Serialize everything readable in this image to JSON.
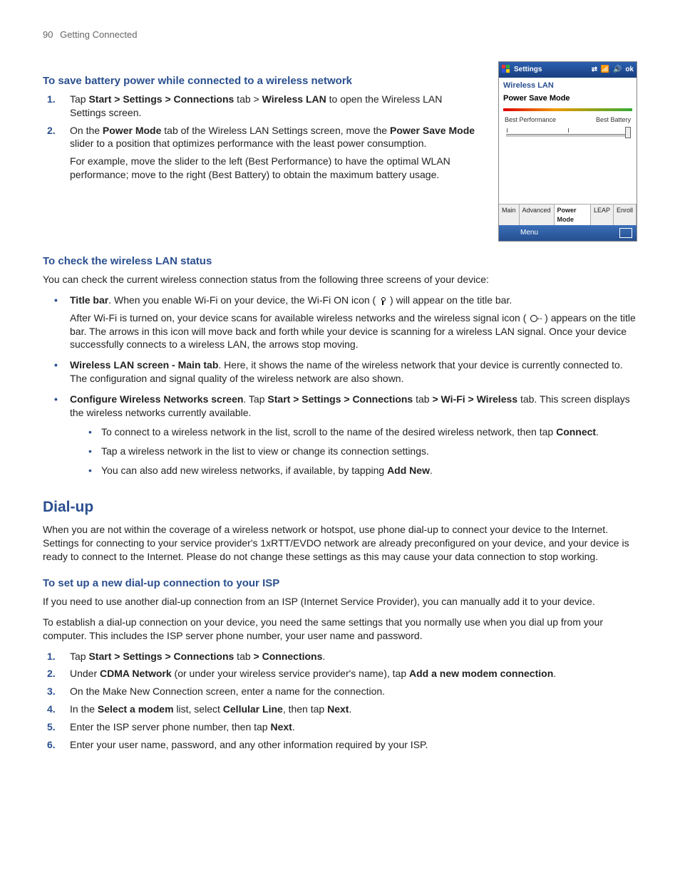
{
  "header": {
    "page_number": "90",
    "chapter": "Getting Connected"
  },
  "sec1": {
    "title": "To save battery power while connected to a wireless network",
    "step1_pre": "Tap ",
    "step1_b1": "Start > Settings > Connections",
    "step1_mid": " tab > ",
    "step1_b2": "Wireless LAN",
    "step1_post": " to open the Wireless LAN Settings screen.",
    "step2_pre": "On the ",
    "step2_b1": "Power Mode",
    "step2_mid1": " tab of the Wireless LAN Settings screen, move the ",
    "step2_b2": "Power Save Mode",
    "step2_post": " slider to a position that optimizes performance with the least power consumption.",
    "step2_note": "For example, move the slider to the left (Best Performance) to have the optimal WLAN performance; move to the right (Best Battery) to obtain the maximum battery usage."
  },
  "screenshot": {
    "title": "Settings",
    "ok": "ok",
    "screen_name": "Wireless LAN",
    "subtitle": "Power Save Mode",
    "left_label": "Best Performance",
    "right_label": "Best Battery",
    "tabs": {
      "main": "Main",
      "advanced": "Advanced",
      "power": "Power Mode",
      "leap": "LEAP",
      "enroll": "Enroll"
    },
    "menu": "Menu"
  },
  "sec2": {
    "title": "To check the wireless LAN status",
    "intro": "You can check the current wireless connection status from the following three screens of your device:",
    "b1_b": "Title bar",
    "b1_t1": ". When you enable Wi-Fi on your device, the Wi-Fi ON icon ( ",
    "b1_t2": " ) will appear on the title bar.",
    "b1_p2a": "After Wi-Fi is turned on, your device scans for available wireless networks and the wireless signal icon ( ",
    "b1_p2b": " ) appears on the title bar. The arrows in this icon will move back and forth while your device is scanning for a wireless LAN signal. Once your device successfully connects to a wireless LAN, the arrows stop moving.",
    "b2_b": "Wireless LAN screen - Main tab",
    "b2_t": ". Here, it shows the name of the wireless network that your device is currently connected to. The configuration and signal quality of the wireless network are also shown.",
    "b3_b": "Configure Wireless Networks screen",
    "b3_t1": ". Tap ",
    "b3_bp": "Start > Settings > Connections",
    "b3_t2": " tab ",
    "b3_bp2": "> Wi-Fi > Wireless",
    "b3_t3": " tab. This screen displays the wireless networks currently available.",
    "sub1a": "To connect to a wireless network in the list, scroll to the name of the desired wireless network, then tap ",
    "sub1b": "Connect",
    "sub1c": ".",
    "sub2": "Tap a wireless network in the list to view or change its connection settings.",
    "sub3a": "You can also add new wireless networks, if available, by tapping ",
    "sub3b": "Add New",
    "sub3c": "."
  },
  "sec3": {
    "title": "Dial-up",
    "intro": "When you are not within the coverage of a wireless network or hotspot, use phone dial-up to connect your device to the Internet. Settings for connecting to your service provider's 1xRTT/EVDO network are already preconfigured on your device, and your device is ready to connect to the Internet. Please do not change these settings as this may cause your data connection to stop working.",
    "sub_title": "To set up a new dial-up connection to your ISP",
    "p1": "If you need to use another dial-up connection from an ISP (Internet Service Provider), you can manually add it to your device.",
    "p2": "To establish a dial-up connection on your device, you need the same settings that you normally use when you dial up from your computer. This includes the ISP server phone number, your user name and password.",
    "s1a": "Tap ",
    "s1b": "Start > Settings > Connections",
    "s1c": " tab ",
    "s1d": "> Connections",
    "s1e": ".",
    "s2a": "Under ",
    "s2b": "CDMA Network",
    "s2c": " (or under your wireless service provider's name), tap ",
    "s2d": "Add a new modem connection",
    "s2e": ".",
    "s3": "On the Make New Connection screen, enter a name for the connection.",
    "s4a": "In the ",
    "s4b": "Select a modem",
    "s4c": " list, select ",
    "s4d": "Cellular Line",
    "s4e": ", then tap ",
    "s4f": "Next",
    "s4g": ".",
    "s5a": "Enter the ISP server phone number, then tap ",
    "s5b": "Next",
    "s5c": ".",
    "s6": "Enter your user name, password, and any other information required by your ISP."
  },
  "nums": {
    "n1": "1.",
    "n2": "2.",
    "n3": "3.",
    "n4": "4.",
    "n5": "5.",
    "n6": "6."
  }
}
